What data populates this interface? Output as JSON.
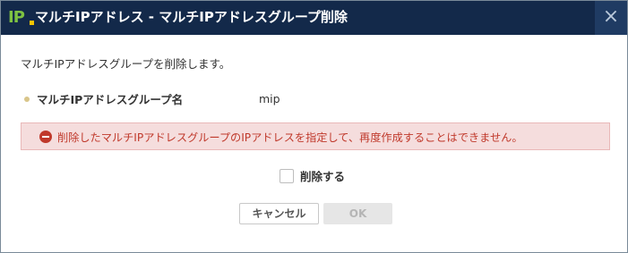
{
  "dialog": {
    "title": "マルチIPアドレス - マルチIPアドレスグループ削除",
    "logo_text": "IP",
    "close_icon": "×",
    "description": "マルチIPアドレスグループを削除します。",
    "field": {
      "label": "マルチIPアドレスグループ名",
      "value": "mip"
    },
    "warning": {
      "icon": "minus-circle-icon",
      "text": "削除したマルチIPアドレスグループのIPアドレスを指定して、再度作成することはできません。",
      "color": "#c0392b"
    },
    "confirm": {
      "label": "削除する",
      "checked": false
    },
    "buttons": {
      "cancel": "キャンセル",
      "ok": "OK"
    }
  },
  "colors": {
    "titlebar": "#13294a",
    "accent": "#7ec242",
    "warning_bg": "#f5dddd"
  }
}
